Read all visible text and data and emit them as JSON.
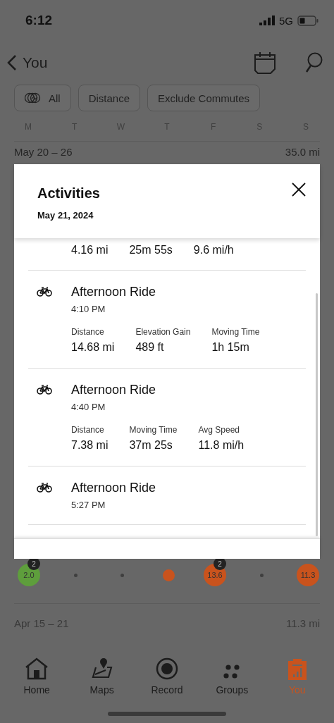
{
  "status_bar": {
    "time": "6:12",
    "network": "5G"
  },
  "nav": {
    "title": "You"
  },
  "filters": [
    {
      "label": "All",
      "kind": "icon"
    },
    {
      "label": "Distance",
      "kind": "plain"
    },
    {
      "label": "Exclude Commutes",
      "kind": "plain"
    }
  ],
  "weekdays": [
    "M",
    "T",
    "W",
    "T",
    "F",
    "S",
    "S"
  ],
  "week_top": {
    "range": "May 20 – 26",
    "total": "35.0 mi"
  },
  "modal": {
    "title": "Activities",
    "date": "May 21, 2024",
    "activities": [
      {
        "stats": [
          {
            "value": "4.16 mi"
          },
          {
            "value": "25m 55s"
          },
          {
            "value": "9.6 mi/h"
          }
        ]
      },
      {
        "title": "Afternoon Ride",
        "time": "4:10 PM",
        "stats": [
          {
            "label": "Distance",
            "value": "14.68 mi"
          },
          {
            "label": "Elevation Gain",
            "value": "489 ft"
          },
          {
            "label": "Moving Time",
            "value": "1h 15m"
          }
        ]
      },
      {
        "title": "Afternoon Ride",
        "time": "4:40 PM",
        "stats": [
          {
            "label": "Distance",
            "value": "7.38 mi"
          },
          {
            "label": "Moving Time",
            "value": "37m 25s"
          },
          {
            "label": "Avg Speed",
            "value": "11.8 mi/h"
          }
        ]
      },
      {
        "title": "Afternoon Ride",
        "time": "5:27 PM"
      }
    ]
  },
  "day_marks": [
    {
      "kind": "bubble",
      "value": "2.0",
      "color": "#5e9e3c",
      "badge": "2"
    },
    {
      "kind": "dot"
    },
    {
      "kind": "dot"
    },
    {
      "kind": "mark",
      "color": "#c9531d"
    },
    {
      "kind": "bubble",
      "value": "13.6",
      "color": "#c9531d",
      "badge": "2"
    },
    {
      "kind": "dot"
    },
    {
      "kind": "bubble",
      "value": "11.3",
      "color": "#c9531d"
    }
  ],
  "week_bottom": {
    "range": "Apr 15 – 21",
    "total": "11.3 mi"
  },
  "tabs": [
    {
      "label": "Home",
      "selected": false
    },
    {
      "label": "Maps",
      "selected": false
    },
    {
      "label": "Record",
      "selected": false
    },
    {
      "label": "Groups",
      "selected": false
    },
    {
      "label": "You",
      "selected": true
    }
  ]
}
